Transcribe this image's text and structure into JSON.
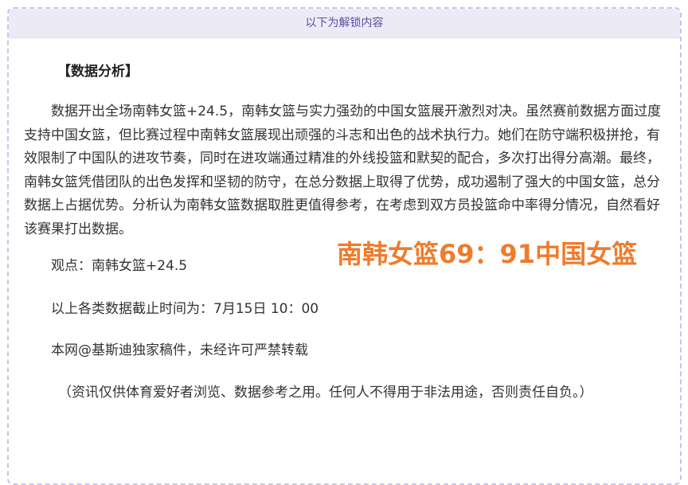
{
  "header": {
    "unlock_label": "以下为解锁内容"
  },
  "article": {
    "section_title": "【数据分析】",
    "paragraph": "数据开出全场南韩女篮+24.5，南韩女篮与实力强劲的中国女篮展开激烈对决。虽然赛前数据方面过度支持中国女篮，但比赛过程中南韩女篮展现出顽强的斗志和出色的战术执行力。她们在防守端积极拼抢，有效限制了中国队的进攻节奏，同时在进攻端通过精准的外线投篮和默契的配合，多次打出得分高潮。最终，南韩女篮凭借团队的出色发挥和坚韧的防守，在总分数据上取得了优势，成功遏制了强大的中国女篮，总分数据上占据优势。分析认为南韩女篮数据取胜更值得参考，在考虑到双方员投篮命中率得分情况，自然看好该赛果打出数据。",
    "viewpoint": "观点：南韩女篮+24.5",
    "cutoff": "以上各类数据截止时间为：7月15日 10：00",
    "copyright": "本网@基斯迪独家稿件，未经许可严禁转载",
    "disclaimer": "（资讯仅供体育爱好者浏览、数据参考之用。任何人不得用于非法用途，否则责任自负。）"
  },
  "score_overlay": {
    "text": "南韩女篮69：91中国女篮",
    "color": "#ef7b2c"
  },
  "colors": {
    "header_bg": "#edeaf7",
    "header_text": "#5a4fa0",
    "border": "#c9c4e2"
  }
}
